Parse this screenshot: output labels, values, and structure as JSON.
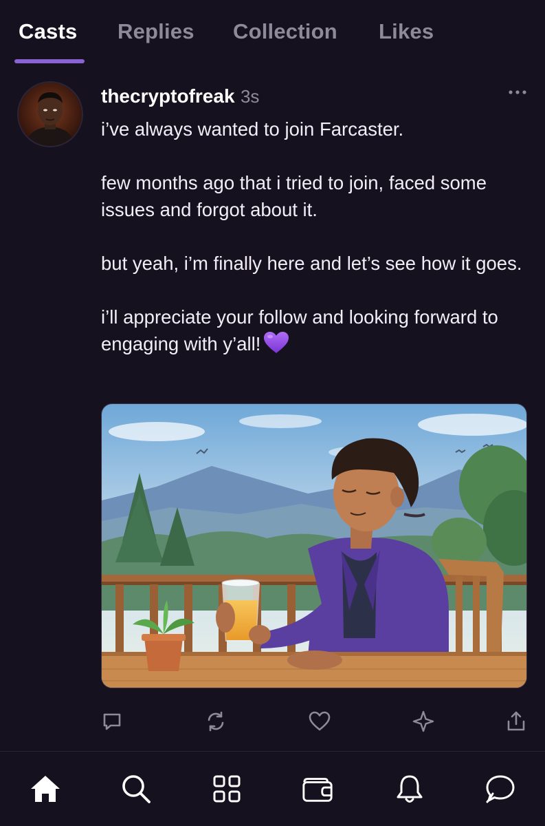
{
  "tabs": {
    "items": [
      {
        "label": "Casts",
        "active": true
      },
      {
        "label": "Replies",
        "active": false
      },
      {
        "label": "Collection",
        "active": false
      },
      {
        "label": "Likes",
        "active": false
      }
    ]
  },
  "cast": {
    "username": "thecryptofreak",
    "timestamp": "3s",
    "paragraphs": [
      "i’ve always wanted to join Farcaster.",
      "few months ago that i tried to join, faced some issues and forgot about it.",
      "but yeah, i’m finally here and let’s see how it goes.",
      "i’ll appreciate your follow and looking forward to engaging with y’all!"
    ],
    "emoji": "purple-heart",
    "actions": [
      "reply-icon",
      "recast-icon",
      "like-icon",
      "bookmark-sparkle-icon",
      "share-icon"
    ]
  },
  "bottom_nav": {
    "items": [
      "home-icon",
      "search-icon",
      "apps-grid-icon",
      "wallet-icon",
      "notifications-bell-icon",
      "messages-icon"
    ]
  },
  "colors": {
    "background": "#16111e",
    "accent": "#8a63d2",
    "muted_text": "#8e8a99",
    "text": "#f1eef7"
  }
}
